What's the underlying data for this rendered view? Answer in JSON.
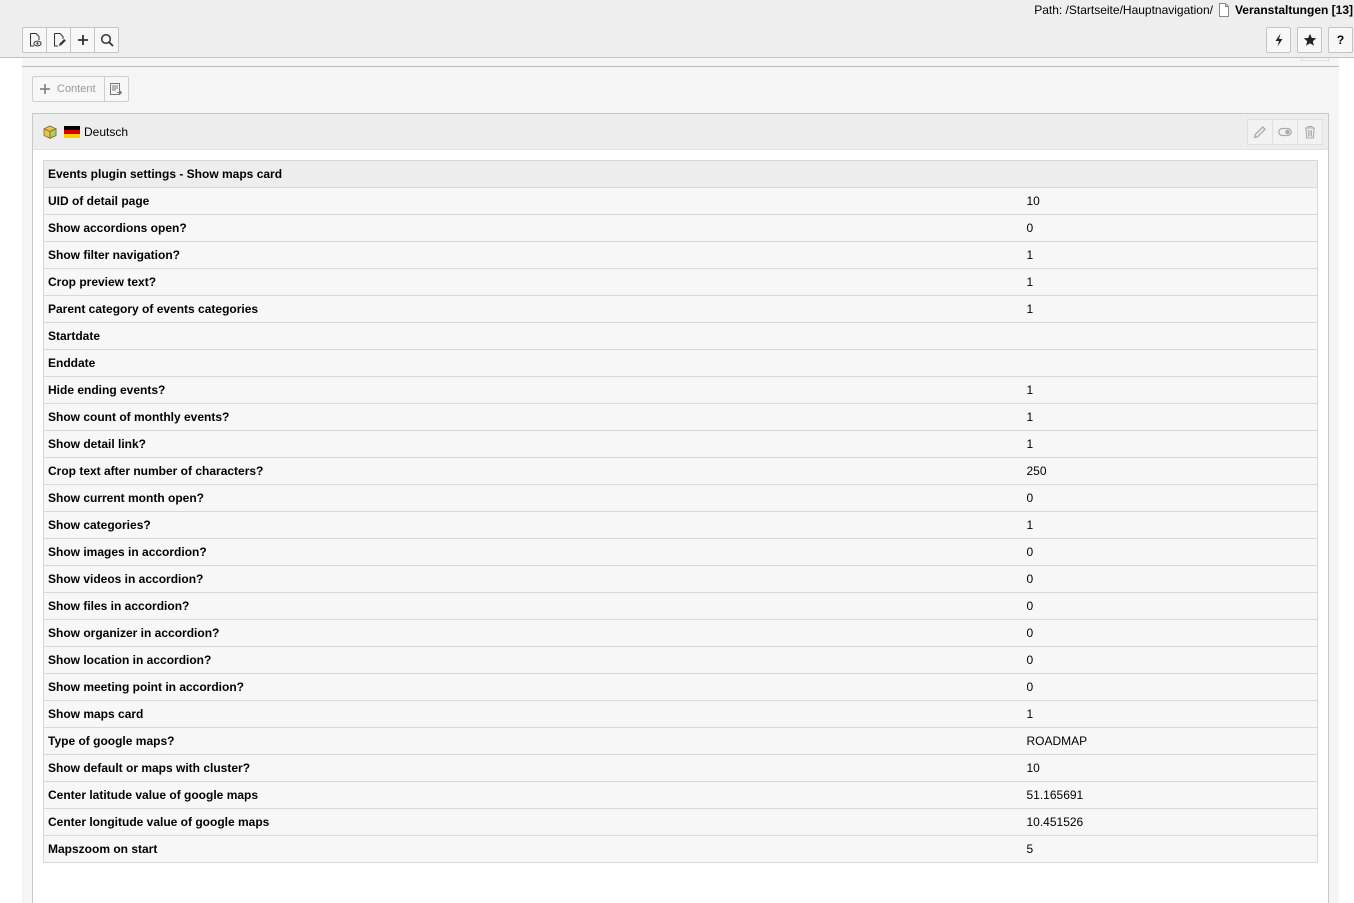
{
  "path": {
    "prefix": "Path: /Startseite/Hauptnavigation/",
    "page_title": "Veranstaltungen [13]"
  },
  "toolbar": {
    "left_icons": [
      "view-page-icon",
      "edit-page-icon",
      "add-icon",
      "search-icon"
    ],
    "right_icons": [
      "shortcut-icon",
      "bookmark-icon"
    ],
    "help_label": "?"
  },
  "content_bar": {
    "add_label": "Content"
  },
  "element": {
    "language": "Deutsch"
  },
  "settings_table": {
    "title": "Events plugin settings - Show maps card",
    "rows": [
      {
        "label": "UID of detail page",
        "value": "10"
      },
      {
        "label": "Show accordions open?",
        "value": "0"
      },
      {
        "label": "Show filter navigation?",
        "value": "1"
      },
      {
        "label": "Crop preview text?",
        "value": "1"
      },
      {
        "label": "Parent category of events categories",
        "value": "1"
      },
      {
        "label": "Startdate",
        "value": ""
      },
      {
        "label": "Enddate",
        "value": ""
      },
      {
        "label": "Hide ending events?",
        "value": "1"
      },
      {
        "label": "Show count of monthly events?",
        "value": "1"
      },
      {
        "label": "Show detail link?",
        "value": "1"
      },
      {
        "label": "Crop text after number of characters?",
        "value": "250"
      },
      {
        "label": "Show current month open?",
        "value": "0"
      },
      {
        "label": "Show categories?",
        "value": "1"
      },
      {
        "label": "Show images in accordion?",
        "value": "0"
      },
      {
        "label": "Show videos in accordion?",
        "value": "0"
      },
      {
        "label": "Show files in accordion?",
        "value": "0"
      },
      {
        "label": "Show organizer in accordion?",
        "value": "0"
      },
      {
        "label": "Show location in accordion?",
        "value": "0"
      },
      {
        "label": "Show meeting point in accordion?",
        "value": "0"
      },
      {
        "label": "Show maps card",
        "value": "1"
      },
      {
        "label": "Type of google maps?",
        "value": "ROADMAP"
      },
      {
        "label": "Show default or maps with cluster?",
        "value": "10"
      },
      {
        "label": "Center latitude value of google maps",
        "value": "51.165691"
      },
      {
        "label": "Center longitude value of google maps",
        "value": "10.451526"
      },
      {
        "label": "Mapszoom on start",
        "value": "5"
      }
    ]
  }
}
